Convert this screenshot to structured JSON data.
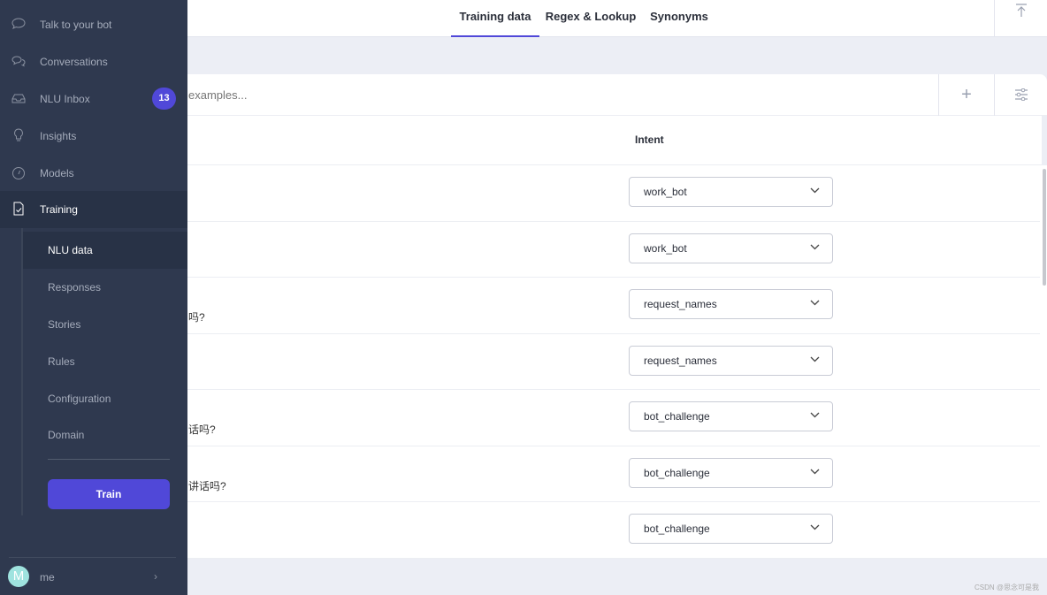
{
  "tabs": [
    {
      "label": "Training data",
      "active": true
    },
    {
      "label": "Regex & Lookup"
    },
    {
      "label": "Synonyms"
    }
  ],
  "search": {
    "placeholder": "examples..."
  },
  "table": {
    "header_intent": "Intent",
    "rows": [
      {
        "text": "",
        "intent": "work_bot"
      },
      {
        "text": "",
        "intent": "work_bot"
      },
      {
        "text": "吗?",
        "intent": "request_names"
      },
      {
        "text": "",
        "intent": "request_names"
      },
      {
        "text": "话吗?",
        "intent": "bot_challenge"
      },
      {
        "text": "讲话吗?",
        "intent": "bot_challenge"
      },
      {
        "text": "",
        "intent": "bot_challenge"
      }
    ]
  },
  "sidebar": {
    "items": [
      {
        "label": "Talk to your bot",
        "icon": "chat-icon"
      },
      {
        "label": "Conversations",
        "icon": "conversations-icon"
      },
      {
        "label": "NLU Inbox",
        "icon": "inbox-icon",
        "badge": "13"
      },
      {
        "label": "Insights",
        "icon": "lightbulb-icon"
      },
      {
        "label": "Models",
        "icon": "gauge-icon"
      },
      {
        "label": "Training",
        "icon": "document-check-icon",
        "active": true
      }
    ],
    "sub_items": [
      {
        "label": "NLU data",
        "active": true
      },
      {
        "label": "Responses"
      },
      {
        "label": "Stories"
      },
      {
        "label": "Rules"
      },
      {
        "label": "Configuration"
      },
      {
        "label": "Domain"
      }
    ],
    "train_label": "Train",
    "user": {
      "initial": "M",
      "name": "me"
    }
  },
  "colors": {
    "accent": "#5048d8",
    "sidebar": "#2f394f"
  },
  "watermark": "CSDN @思念可是我"
}
